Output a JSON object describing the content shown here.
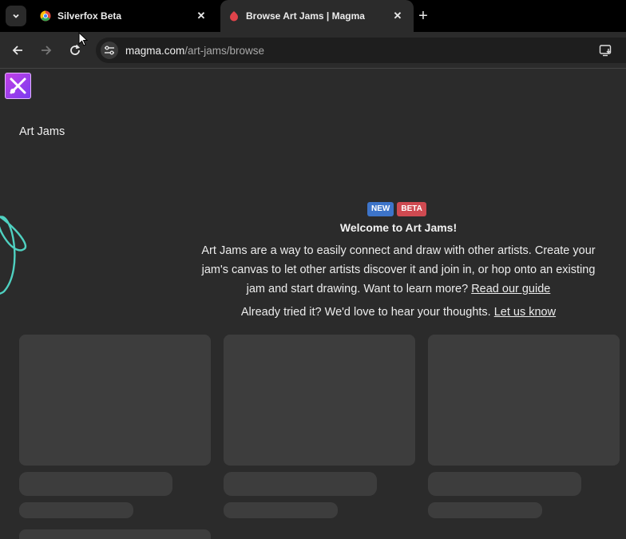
{
  "browser": {
    "tabs": [
      {
        "title": "Silverfox Beta",
        "close": "✕"
      },
      {
        "title": "Browse Art Jams | Magma",
        "close": "✕"
      }
    ],
    "new_tab": "+",
    "url_host": "magma.com",
    "url_path": "/art-jams/browse"
  },
  "page": {
    "section_title": "Art Jams",
    "badges": {
      "new": "NEW",
      "beta": "BETA"
    },
    "welcome_title": "Welcome to Art Jams!",
    "description": "Art Jams are a way to easily connect and draw with other artists. Create your jam's canvas to let other artists discover it and join in, or hop onto an existing jam and start drawing. Want to learn more?",
    "guide_link": "Read our guide",
    "feedback_text": "Already tried it? We'd love to hear your thoughts.",
    "feedback_link": "Let us know"
  },
  "colors": {
    "badge_new": "#3d74c9",
    "badge_beta": "#cf4a51",
    "accent_swirl": "#4fd1c1",
    "skeleton": "#3d3d3d"
  }
}
